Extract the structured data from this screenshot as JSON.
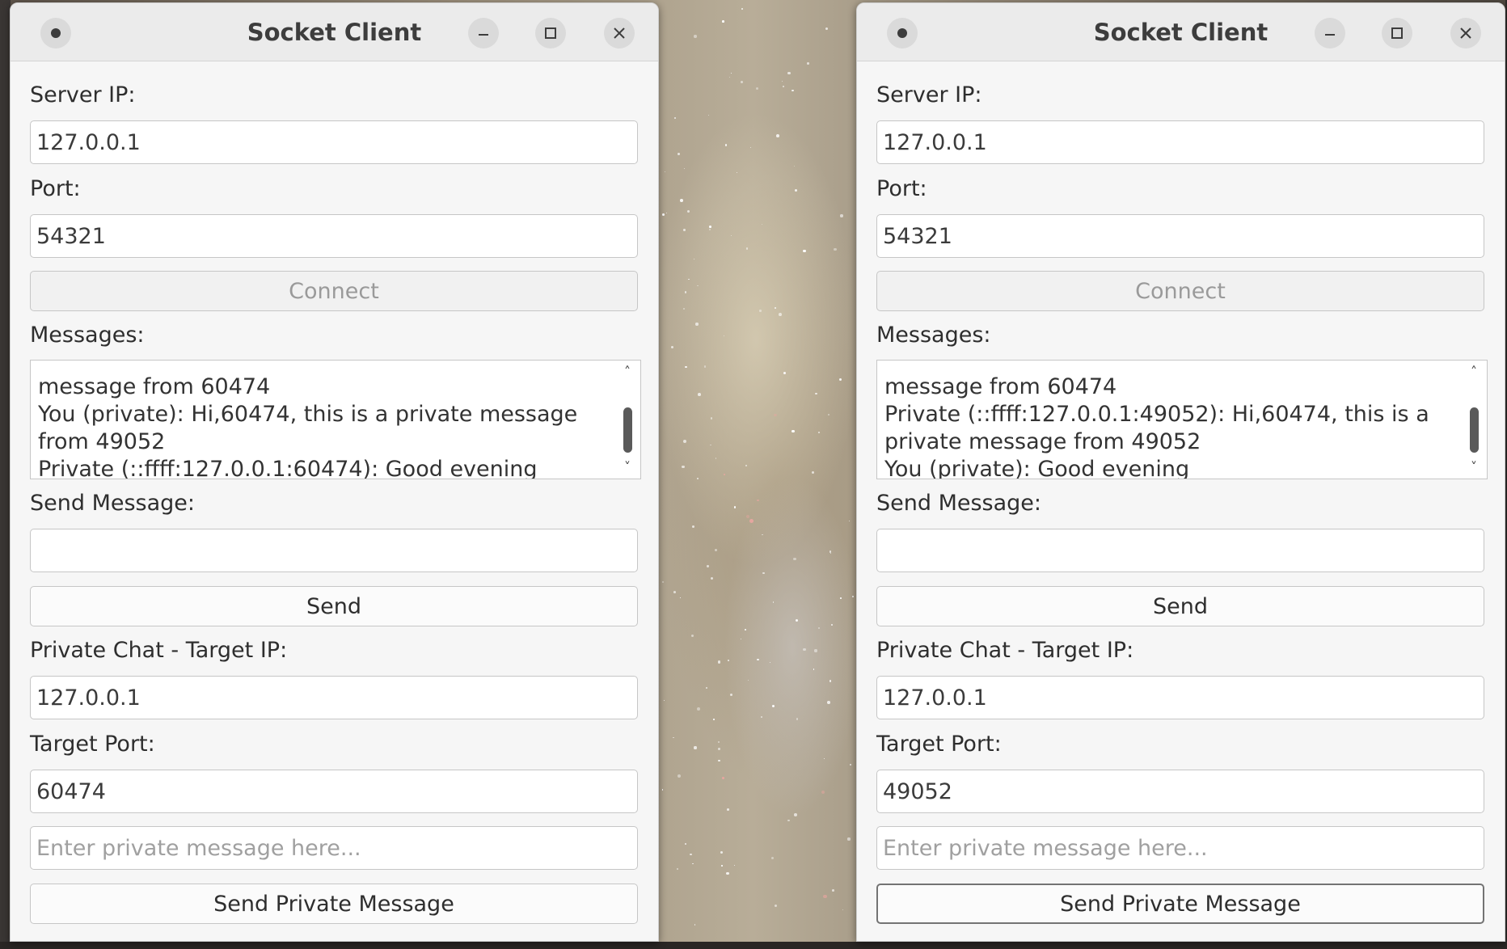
{
  "windows": [
    {
      "title": "Socket Client",
      "server_ip_label": "Server IP:",
      "server_ip": "127.0.0.1",
      "port_label": "Port:",
      "port": "54321",
      "connect_label": "Connect",
      "messages_label": "Messages:",
      "messages": [
        "message from 60474",
        "You (private): Hi,60474, this is a private message",
        "from 49052",
        "Private (::ffff:127.0.0.1:60474): Good evening"
      ],
      "send_message_label": "Send Message:",
      "send_message_value": "",
      "send_label": "Send",
      "target_ip_label": "Private Chat - Target IP:",
      "target_ip": "127.0.0.1",
      "target_port_label": "Target Port:",
      "target_port": "60474",
      "private_placeholder": "Enter private message here...",
      "send_private_label": "Send Private Message"
    },
    {
      "title": "Socket Client",
      "server_ip_label": "Server IP:",
      "server_ip": "127.0.0.1",
      "port_label": "Port:",
      "port": "54321",
      "connect_label": "Connect",
      "messages_label": "Messages:",
      "messages": [
        "message from 60474",
        "Private (::ffff:127.0.0.1:49052): Hi,60474, this is a",
        "private message from 49052",
        "You (private): Good evening"
      ],
      "send_message_label": "Send Message:",
      "send_message_value": "",
      "send_label": "Send",
      "target_ip_label": "Private Chat - Target IP:",
      "target_ip": "127.0.0.1",
      "target_port_label": "Target Port:",
      "target_port": "49052",
      "private_placeholder": "Enter private message here...",
      "send_private_label": "Send Private Message"
    }
  ],
  "colors": {
    "window_bg": "#f6f6f6",
    "titlebar_bg": "#ebebeb",
    "text": "#2e2e2e",
    "disabled_text": "#9a9a9a"
  }
}
